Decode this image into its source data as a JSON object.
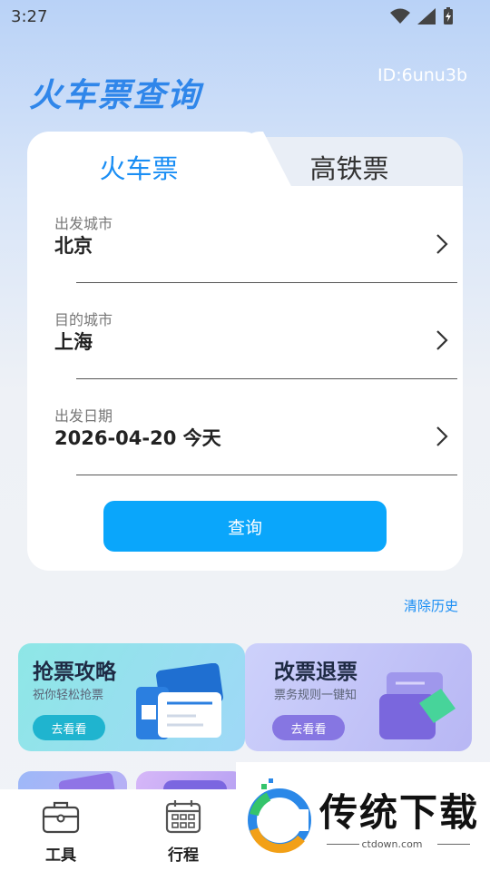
{
  "status_bar": {
    "time": "3:27"
  },
  "header": {
    "title": "火车票查询",
    "user_id": "ID:6unu3b"
  },
  "tabs": [
    {
      "label": "火车票",
      "active": true
    },
    {
      "label": "高铁票",
      "active": false
    }
  ],
  "form": {
    "departure": {
      "label": "出发城市",
      "value": "北京"
    },
    "destination": {
      "label": "目的城市",
      "value": "上海"
    },
    "date": {
      "label": "出发日期",
      "value": "2026-04-20 今天"
    },
    "query_button": "查询"
  },
  "clear_history": "清除历史",
  "promos": [
    {
      "title": "抢票攻略",
      "subtitle": "祝你轻松抢票",
      "button": "去看看",
      "accent": "#18b3c8"
    },
    {
      "title": "改票退票",
      "subtitle": "票务规则一键知",
      "button": "去看看",
      "accent": "#8a7ce6"
    }
  ],
  "bottom_nav": [
    {
      "label": "工具",
      "icon": "toolbox-icon"
    },
    {
      "label": "行程",
      "icon": "calendar-icon"
    }
  ],
  "watermark": {
    "text": "传统下载",
    "url": "ctdown.com"
  },
  "colors": {
    "primary": "#0aa6fb",
    "title_blue": "#2f86ea",
    "tab_active_text": "#1a8ef4"
  }
}
